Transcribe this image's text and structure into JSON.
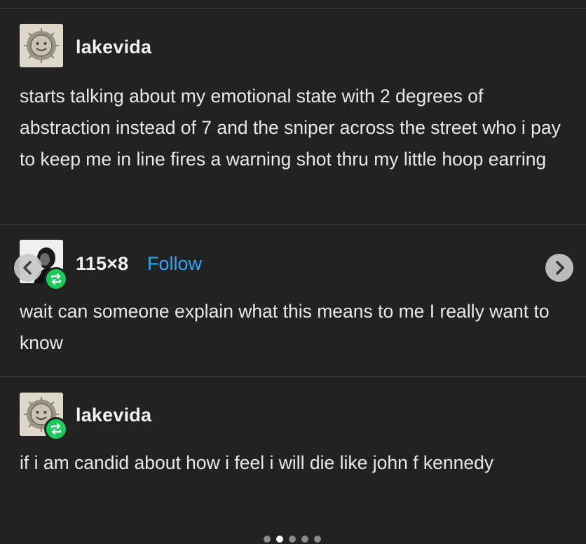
{
  "posts": [
    {
      "username": "lakevida",
      "avatar_icon": "smiling-sun-icon",
      "text": "starts talking about my emotional state with 2 degrees of abstraction instead of 7 and the sniper across the street who i pay to keep me in line fires a warning shot thru my little hoop earring"
    },
    {
      "username": "115×8",
      "follow_label": "Follow",
      "avatar_icon": "user-portrait-icon",
      "badge_icon": "reblog-icon",
      "text": "wait can someone explain what this means to me I really want to know"
    },
    {
      "username": "lakevida",
      "avatar_icon": "smiling-sun-icon",
      "badge_icon": "reblog-icon",
      "text": "if i am candid about how i feel i will die like john f kennedy"
    }
  ],
  "carousel": {
    "prev_icon": "chevron-left-icon",
    "next_icon": "chevron-right-icon",
    "slide_count": 5,
    "active_slide": 2
  },
  "colors": {
    "background": "#222222",
    "text": "#e8e8e8",
    "follow": "#2ea8ff",
    "reblog_badge": "#1dc95b"
  }
}
